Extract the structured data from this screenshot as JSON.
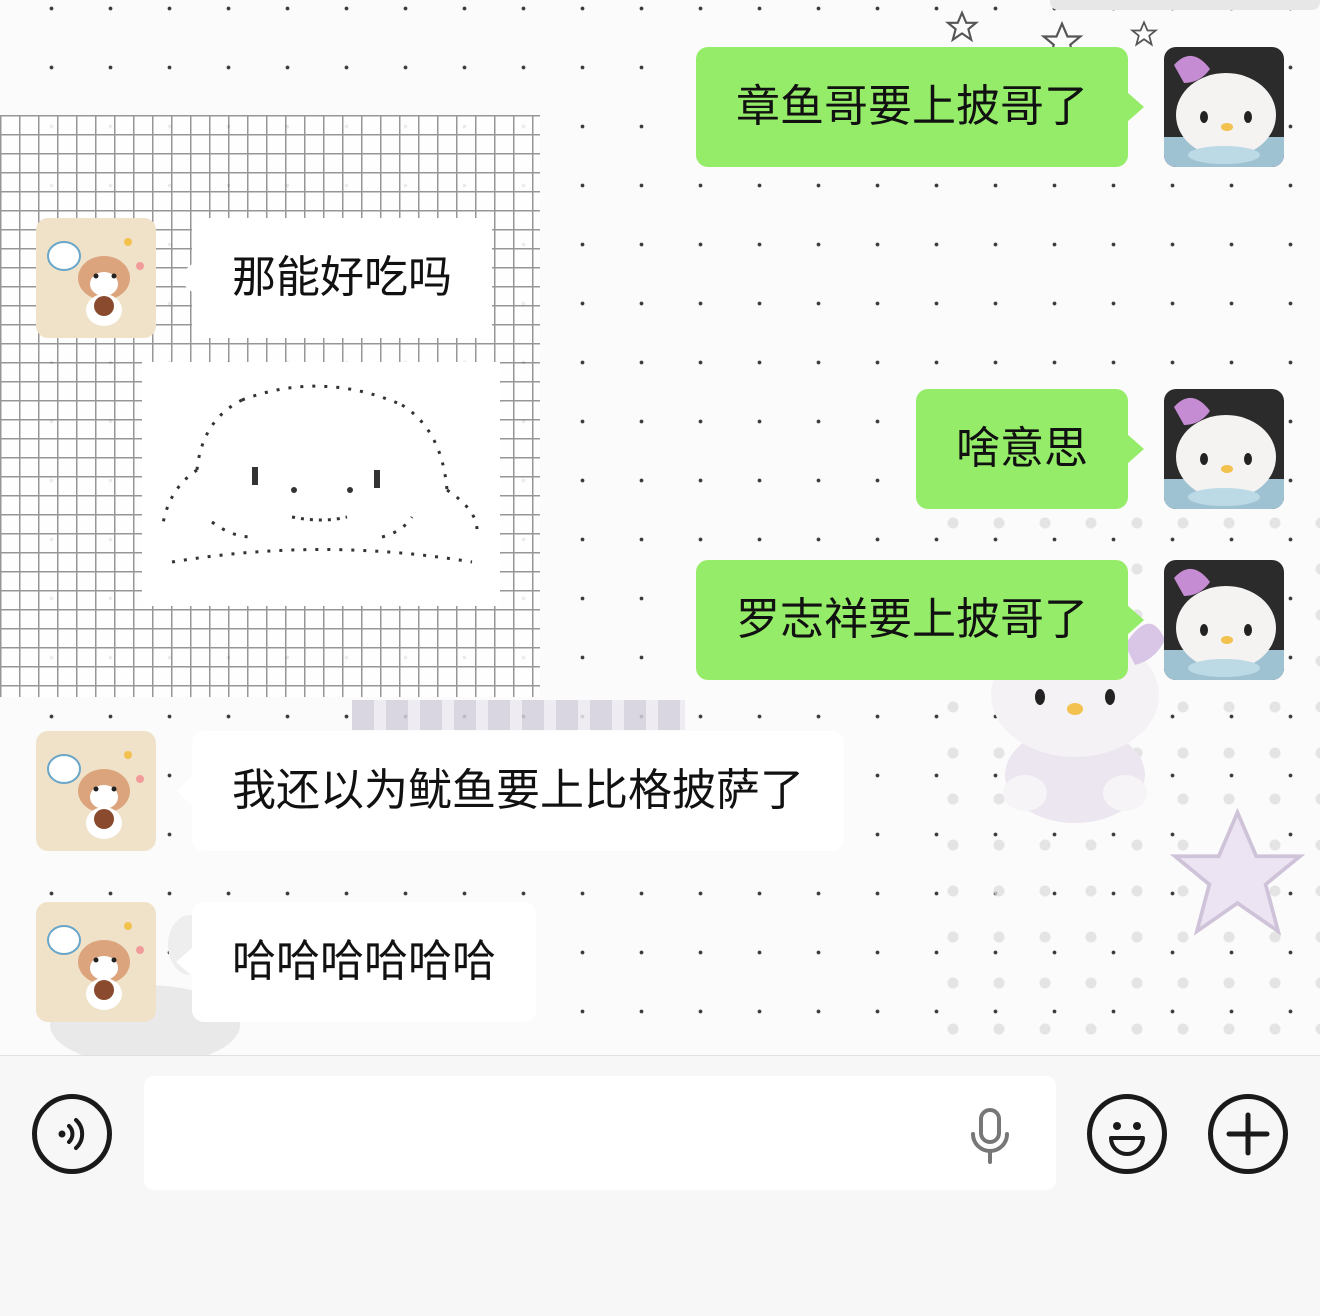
{
  "messages": [
    {
      "side": "right",
      "text": "章鱼哥要上披哥了",
      "avatar": "hello-kitty-avatar"
    },
    {
      "side": "left",
      "text": "那能好吃吗",
      "avatar": "puppy-avatar"
    },
    {
      "side": "right",
      "text": "啥意思",
      "avatar": "hello-kitty-avatar"
    },
    {
      "side": "right",
      "text": "罗志祥要上披哥了",
      "avatar": "hello-kitty-avatar"
    },
    {
      "side": "left",
      "text": "我还以为鱿鱼要上比格披萨了",
      "avatar": "puppy-avatar"
    },
    {
      "side": "left",
      "text": "哈哈哈哈哈哈",
      "avatar": "puppy-avatar"
    }
  ],
  "input_bar": {
    "value": "",
    "placeholder": "",
    "voice_icon": "voice-icon",
    "mic_icon": "microphone-icon",
    "emoji_icon": "emoji-icon",
    "plus_icon": "plus-icon"
  },
  "colors": {
    "sent_bubble": "#95ec69",
    "received_bubble": "#ffffff",
    "input_bar_bg": "#f7f7f7"
  }
}
